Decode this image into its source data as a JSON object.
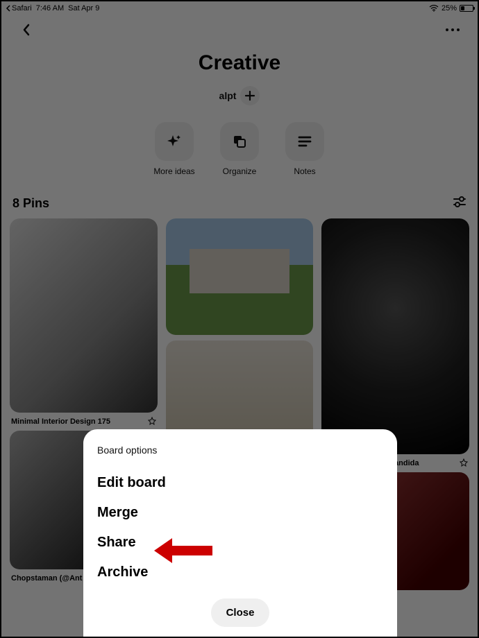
{
  "status": {
    "back_app": "Safari",
    "time": "7:46 AM",
    "date": "Sat Apr 9",
    "battery_pct": "25%"
  },
  "header": {
    "board_title": "Creative",
    "collaborator_hint": "alpt"
  },
  "actions": {
    "more_ideas": "More ideas",
    "organize": "Organize",
    "notes": "Notes"
  },
  "pins": {
    "count_label": "8 Pins",
    "items": [
      {
        "title": "Minimal Interior Design 175"
      },
      {
        "title": ""
      },
      {
        "title": "R nineT Tracker a Bandida"
      },
      {
        "title": "Chopstaman (@Ant"
      },
      {
        "title": ""
      }
    ]
  },
  "sheet": {
    "title": "Board options",
    "edit": "Edit board",
    "merge": "Merge",
    "share": "Share",
    "archive": "Archive",
    "close": "Close"
  }
}
